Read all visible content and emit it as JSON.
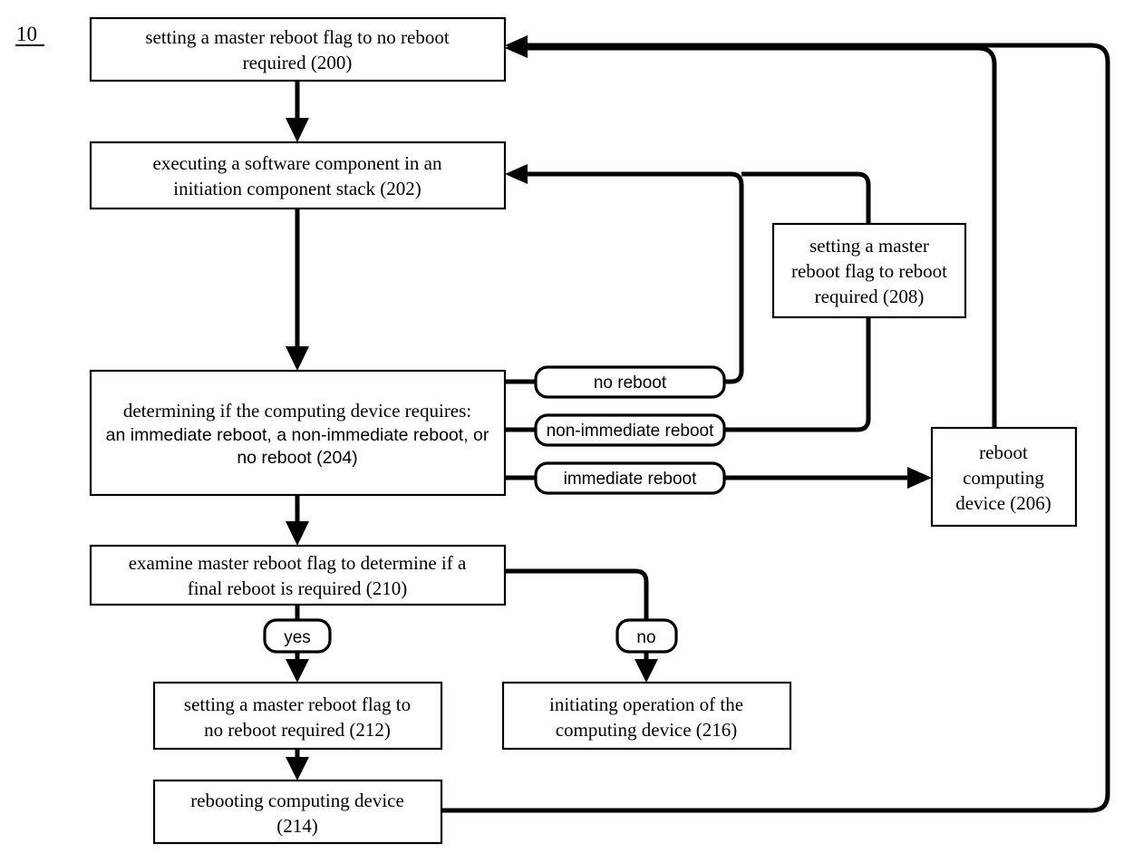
{
  "figure": {
    "label": "10",
    "kind": "patent-flowchart",
    "ink_color": "#000000",
    "background_color": "#ffffff"
  },
  "nodes": {
    "n200": {
      "id": "200",
      "shape": "rectangle",
      "lines": [
        "setting a master reboot flag to no reboot",
        "required (200)"
      ],
      "font": "serif"
    },
    "n202": {
      "id": "202",
      "shape": "rectangle",
      "lines": [
        "executing a software component in an",
        "initiation component stack (202)"
      ],
      "font": "serif"
    },
    "n204": {
      "id": "204",
      "shape": "rectangle",
      "lines": [
        "determining if the computing device requires:",
        "an immediate reboot, a non-immediate reboot, or",
        "no reboot (204)"
      ],
      "font": "mixed-serif-first-line"
    },
    "n206": {
      "id": "206",
      "shape": "rectangle",
      "lines": [
        "reboot",
        "computing",
        "device (206)"
      ],
      "font": "serif"
    },
    "n208": {
      "id": "208",
      "shape": "rectangle",
      "lines": [
        "setting a master",
        "reboot flag to reboot",
        "required (208)"
      ],
      "font": "serif"
    },
    "n210": {
      "id": "210",
      "shape": "rectangle",
      "lines": [
        "examine master reboot flag to determine if a",
        "final reboot is required (210)"
      ],
      "font": "serif"
    },
    "n212": {
      "id": "212",
      "shape": "rectangle",
      "lines": [
        "setting a master reboot flag to",
        "no reboot required (212)"
      ],
      "font": "serif"
    },
    "n214": {
      "id": "214",
      "shape": "rectangle",
      "lines": [
        "rebooting computing device",
        "(214)"
      ],
      "font": "serif"
    },
    "n216": {
      "id": "216",
      "shape": "rectangle",
      "lines": [
        "initiating operation of the",
        "computing device (216)"
      ],
      "font": "serif"
    }
  },
  "branch_labels": {
    "no_reboot": "no reboot",
    "non_immediate_reboot": "non-immediate reboot",
    "immediate_reboot": "immediate reboot",
    "yes": "yes",
    "no": "no"
  },
  "edges": [
    {
      "name": "200-to-202",
      "from": "200",
      "to": "202",
      "label": ""
    },
    {
      "name": "202-to-204",
      "from": "202",
      "to": "204",
      "label": ""
    },
    {
      "name": "204-to-210",
      "from": "204",
      "to": "210",
      "label": ""
    },
    {
      "name": "204-no-reboot-to-202",
      "from": "204",
      "to": "202",
      "label": "no reboot"
    },
    {
      "name": "204-non-immediate-to-208",
      "from": "204",
      "to": "208",
      "label": "non-immediate reboot"
    },
    {
      "name": "204-immediate-to-206",
      "from": "204",
      "to": "206",
      "label": "immediate reboot"
    },
    {
      "name": "208-to-202",
      "from": "208",
      "to": "202",
      "label": ""
    },
    {
      "name": "206-to-200",
      "from": "206",
      "to": "200",
      "label": ""
    },
    {
      "name": "210-yes-to-212",
      "from": "210",
      "to": "212",
      "label": "yes"
    },
    {
      "name": "210-no-to-216",
      "from": "210",
      "to": "216",
      "label": "no"
    },
    {
      "name": "212-to-214",
      "from": "212",
      "to": "214",
      "label": ""
    },
    {
      "name": "214-to-200",
      "from": "214",
      "to": "200",
      "label": ""
    }
  ]
}
